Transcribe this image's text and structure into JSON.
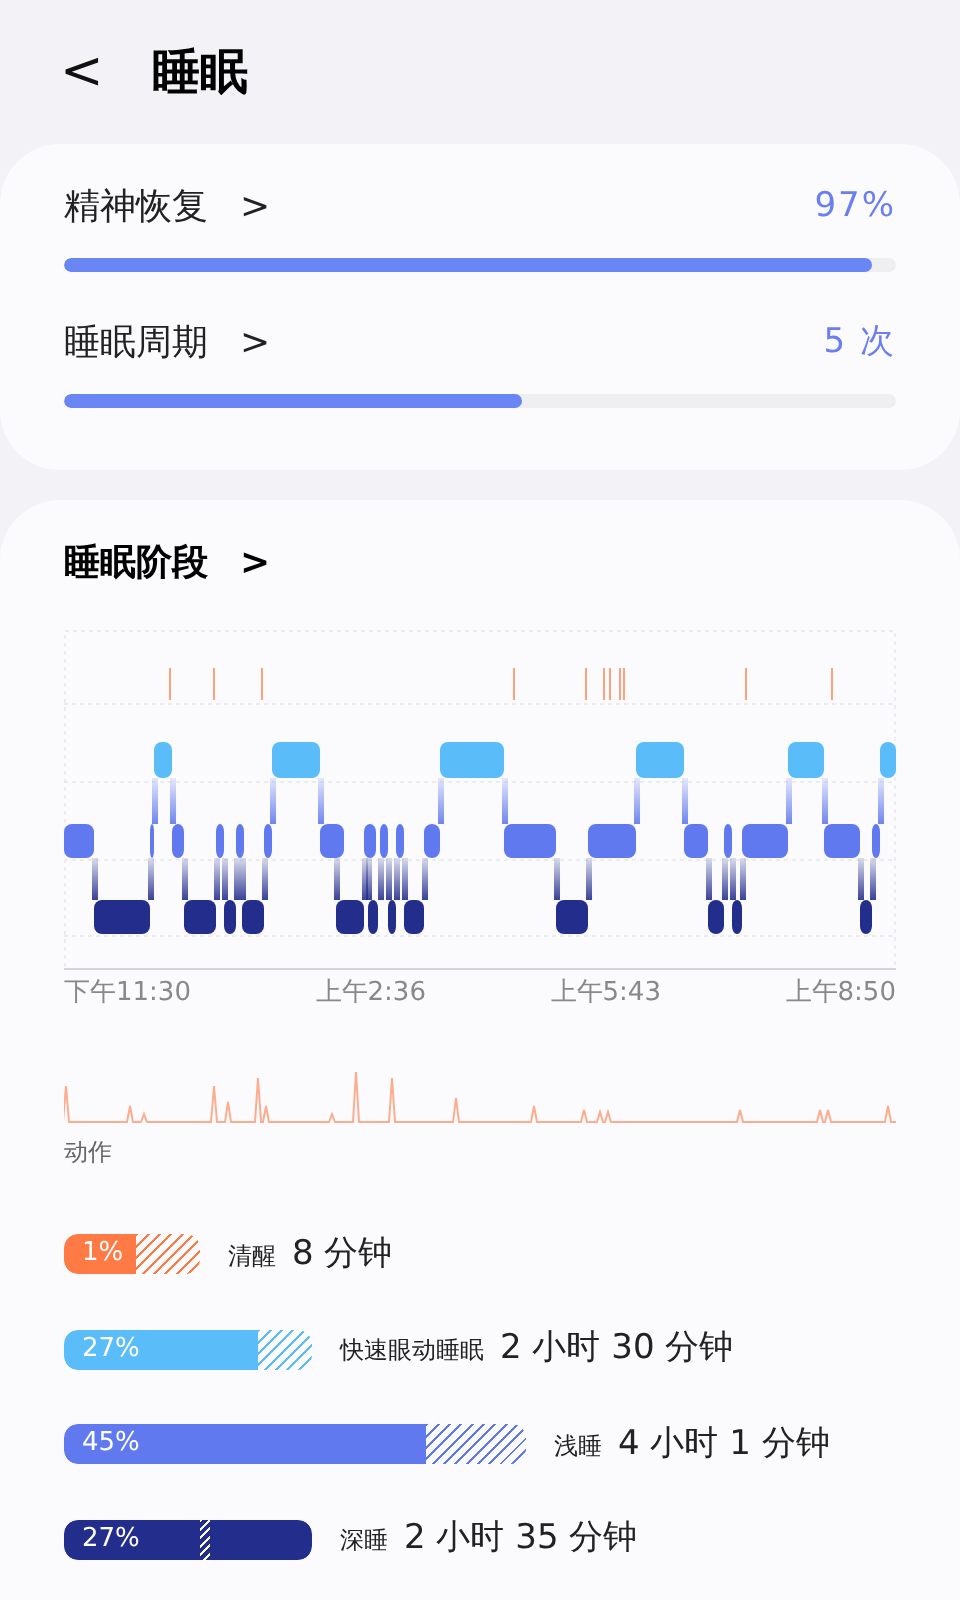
{
  "header": {
    "back": "<",
    "title": "睡眠"
  },
  "metrics": [
    {
      "label": "精神恢复",
      "chevron": ">",
      "value": "97%",
      "level": 0.97
    },
    {
      "label": "睡眠周期",
      "chevron": ">",
      "value": "5 次",
      "level": 0.55
    }
  ],
  "stages_section": {
    "title": "睡眠阶段",
    "chevron": ">",
    "time_labels": [
      "下午11:30",
      "上午2:36",
      "上午5:43",
      "上午8:50"
    ],
    "movement_label": "动作",
    "stages": [
      {
        "kind": "awake",
        "percent": "1%",
        "name": "清醒",
        "duration": "8 分钟",
        "color": "#ff7a45"
      },
      {
        "kind": "rem",
        "percent": "27%",
        "name": "快速眼动睡眠",
        "duration": "2 小时 30 分钟",
        "color": "#5bbcfa"
      },
      {
        "kind": "light",
        "percent": "45%",
        "name": "浅睡",
        "duration": "4 小时 1 分钟",
        "color": "#6079ee"
      },
      {
        "kind": "deep",
        "percent": "27%",
        "name": "深睡",
        "duration": "2 小时 35 分钟",
        "color": "#232d8c"
      }
    ]
  }
}
